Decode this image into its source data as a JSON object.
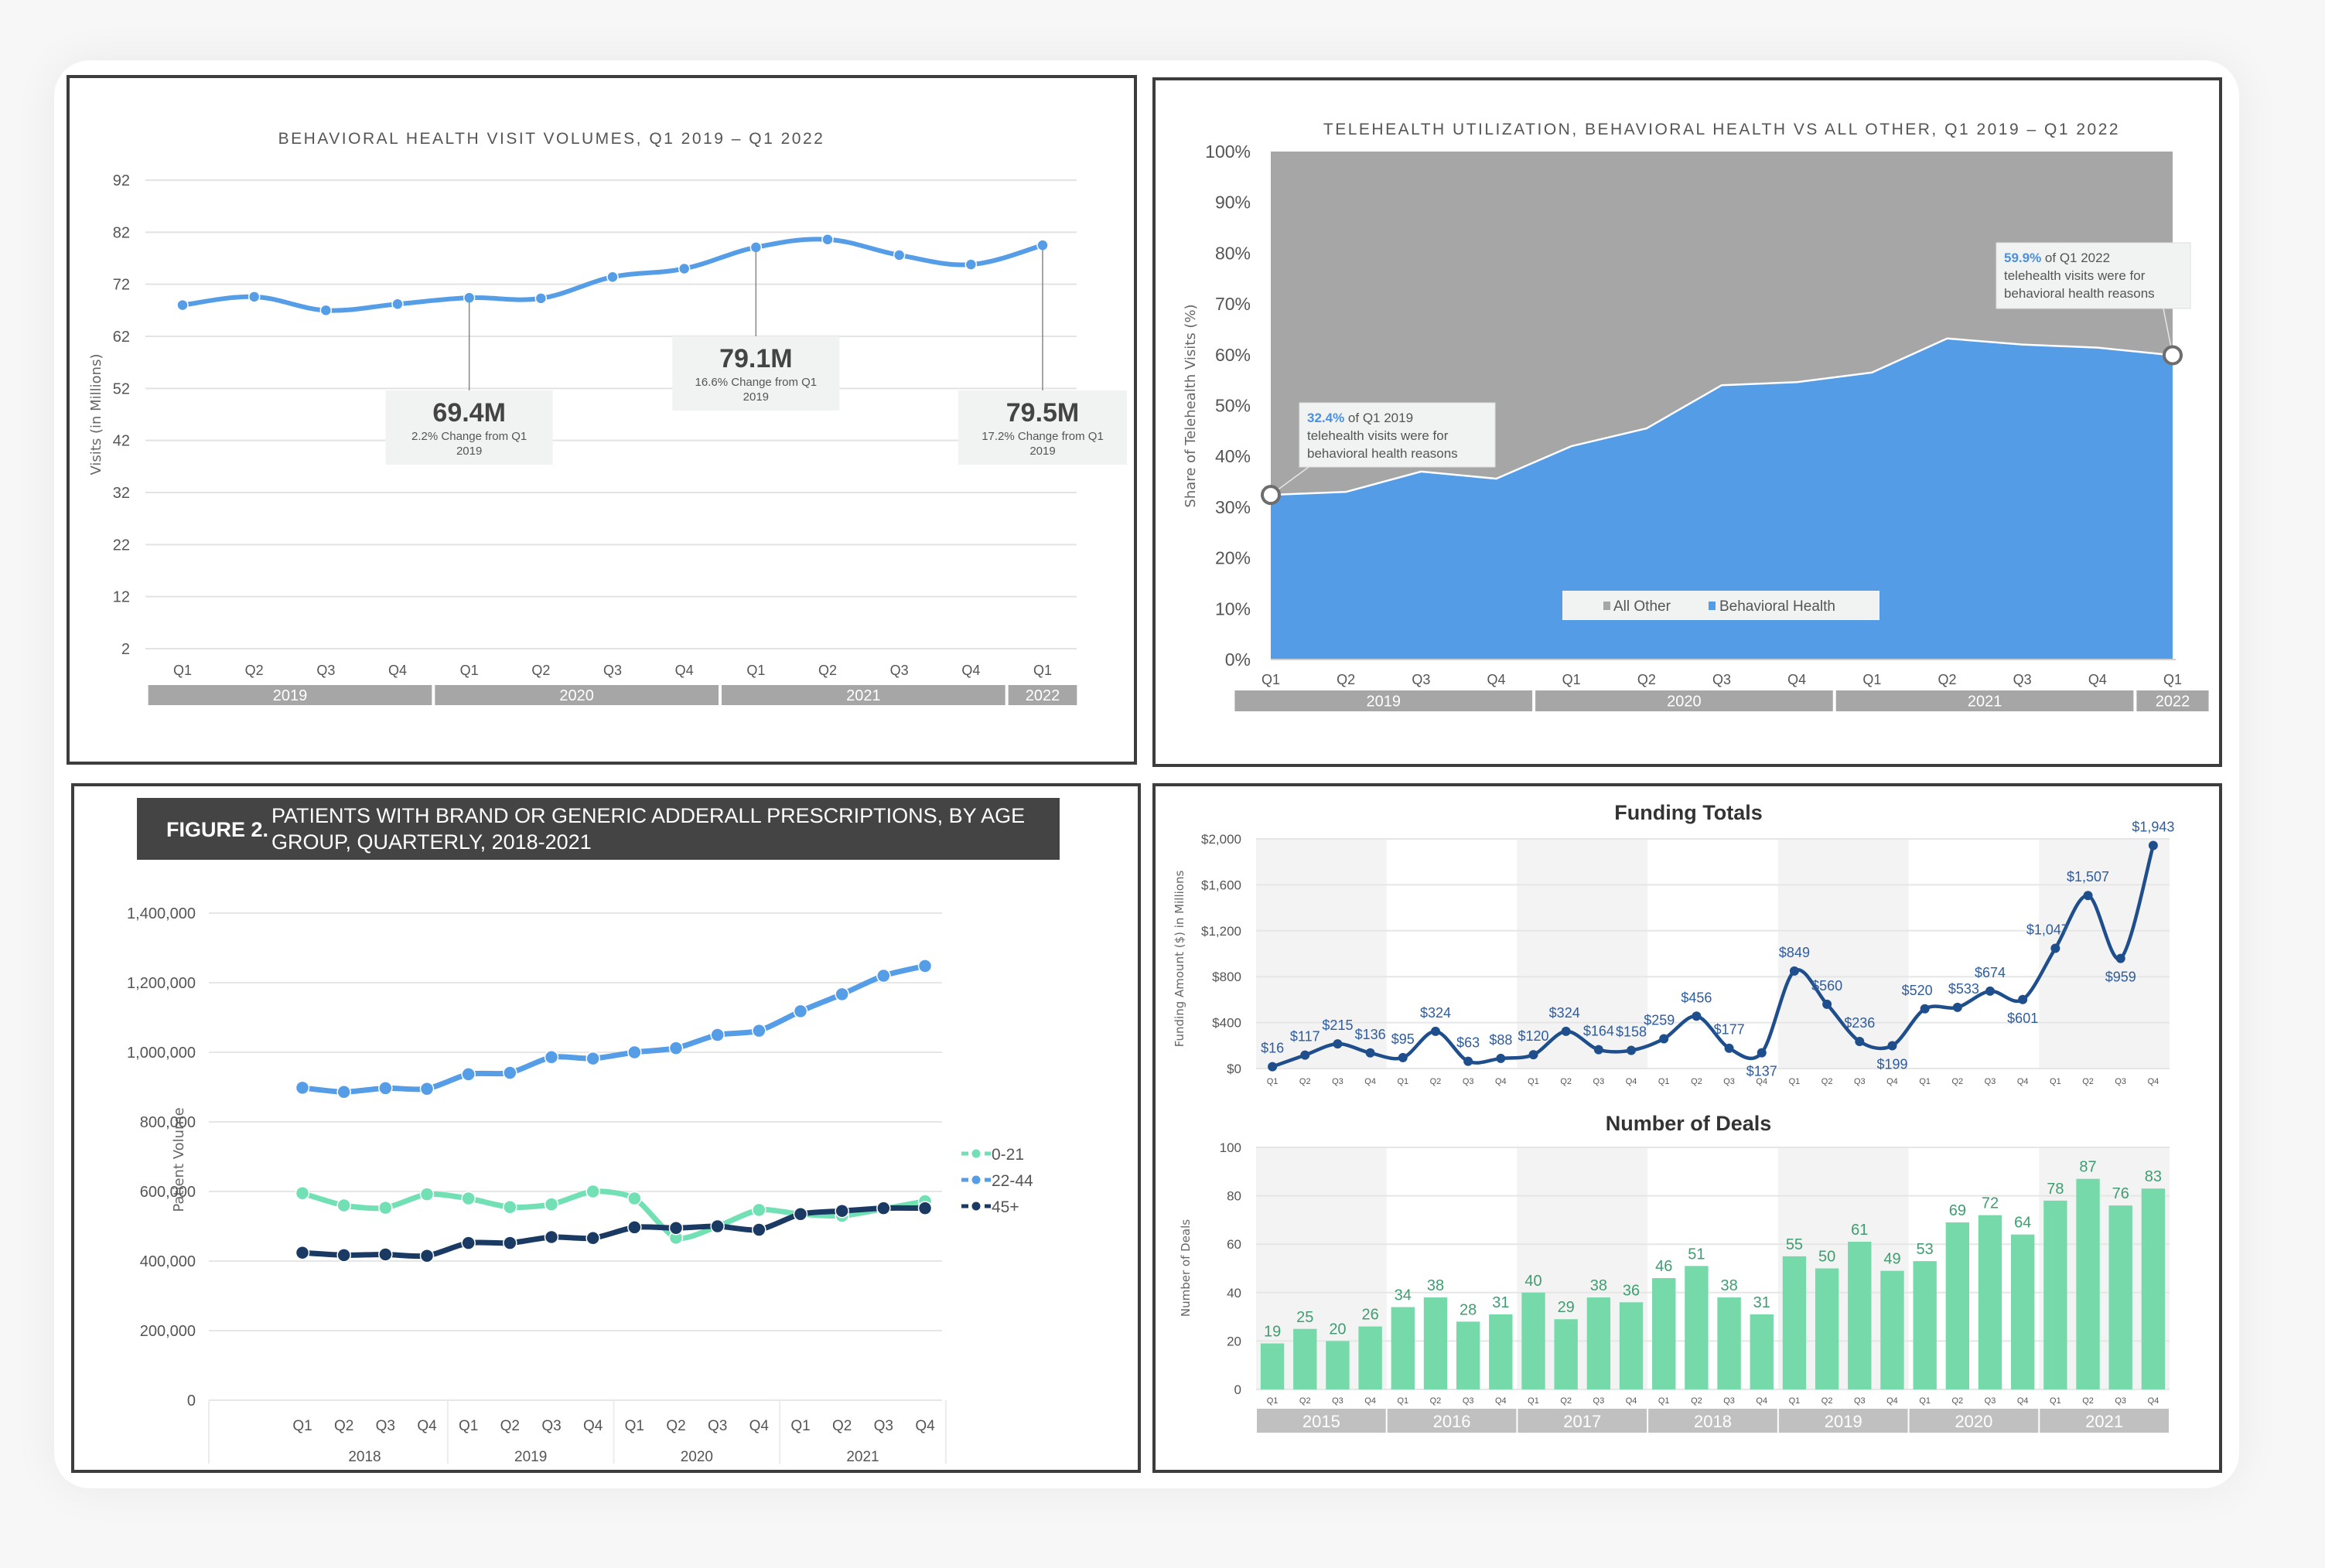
{
  "chart_data": [
    {
      "id": "visit-volumes",
      "type": "line",
      "title": "BEHAVIORAL HEALTH VISIT VOLUMES, Q1 2019 – Q1 2022",
      "xlabel": "",
      "ylabel": "Visits (in Millions)",
      "ylim": [
        2,
        92
      ],
      "yticks": [
        "92",
        "82",
        "72",
        "62",
        "52",
        "42",
        "32",
        "22",
        "12",
        "2"
      ],
      "grid": true,
      "categories": [
        "Q1",
        "Q2",
        "Q3",
        "Q4",
        "Q1",
        "Q2",
        "Q3",
        "Q4",
        "Q1",
        "Q2",
        "Q3",
        "Q4",
        "Q1"
      ],
      "year_groups": [
        {
          "label": "2019",
          "span": 4
        },
        {
          "label": "2020",
          "span": 4
        },
        {
          "label": "2021",
          "span": 4
        },
        {
          "label": "2022",
          "span": 1
        }
      ],
      "series": [
        {
          "name": "Visits",
          "color": "#559DE6",
          "values": [
            68.0,
            69.6,
            67.0,
            68.2,
            69.4,
            69.3,
            73.4,
            75.0,
            79.1,
            80.6,
            77.6,
            75.8,
            79.5
          ]
        }
      ],
      "annotations": [
        {
          "index": 4,
          "value": "69.4M",
          "text": "2.2% Change from Q1 2019"
        },
        {
          "index": 8,
          "value": "79.1M",
          "text": "16.6% Change from Q1 2019"
        },
        {
          "index": 12,
          "value": "79.5M",
          "text": "17.2% Change from Q1 2019"
        }
      ]
    },
    {
      "id": "telehealth-share",
      "type": "area",
      "title": "TELEHEALTH UTILIZATION, BEHAVIORAL HEALTH VS ALL OTHER, Q1 2019 – Q1 2022",
      "xlabel": "",
      "ylabel": "Share of Telehealth Visits (%)",
      "ylim": [
        0,
        100
      ],
      "yticks": [
        "100%",
        "90%",
        "80%",
        "70%",
        "60%",
        "50%",
        "40%",
        "30%",
        "20%",
        "10%",
        "0%"
      ],
      "categories": [
        "Q1",
        "Q2",
        "Q3",
        "Q4",
        "Q1",
        "Q2",
        "Q3",
        "Q4",
        "Q1",
        "Q2",
        "Q3",
        "Q4",
        "Q1"
      ],
      "year_groups": [
        {
          "label": "2019",
          "span": 4
        },
        {
          "label": "2020",
          "span": 4
        },
        {
          "label": "2021",
          "span": 4
        },
        {
          "label": "2022",
          "span": 1
        }
      ],
      "stacked": true,
      "series": [
        {
          "name": "All Other",
          "color": "#A6A6A6",
          "values": [
            67.6,
            67.0,
            63.0,
            64.4,
            58.0,
            54.5,
            46.0,
            45.4,
            43.5,
            36.8,
            38.0,
            38.6,
            40.1
          ]
        },
        {
          "name": "Behavioral Health",
          "color": "#559CE6",
          "values": [
            32.4,
            33.0,
            37.0,
            35.6,
            42.0,
            45.5,
            54.0,
            54.6,
            56.5,
            63.2,
            62.0,
            61.4,
            59.9
          ]
        }
      ],
      "legend": {
        "position": "bottom-center",
        "items": [
          "All Other",
          "Behavioral Health"
        ]
      },
      "annotations": [
        {
          "index": 0,
          "highlight": "32.4%",
          "text_1": " of Q1 2019",
          "text_2": "telehealth visits were for",
          "text_3": "behavioral health reasons"
        },
        {
          "index": 12,
          "highlight": "59.9%",
          "text_1": " of Q1 2022",
          "text_2": "telehealth visits were for",
          "text_3": "behavioral health reasons"
        }
      ]
    },
    {
      "id": "adderall-patients",
      "type": "line",
      "figure_label": "FIGURE 2.",
      "title": "PATIENTS WITH BRAND OR GENERIC ADDERALL PRESCRIPTIONS, BY AGE GROUP, QUARTERLY, 2018-2021",
      "xlabel": "",
      "ylabel": "Patient Volume",
      "ylim": [
        0,
        1400000
      ],
      "yticks": [
        "1,400,000",
        "1,200,000",
        "1,000,000",
        "800,000",
        "600,000",
        "400,000",
        "200,000",
        "0"
      ],
      "grid": true,
      "categories": [
        "Q1",
        "Q2",
        "Q3",
        "Q4",
        "Q1",
        "Q2",
        "Q3",
        "Q4",
        "Q1",
        "Q2",
        "Q3",
        "Q4",
        "Q1",
        "Q2",
        "Q3",
        "Q4"
      ],
      "year_groups": [
        {
          "label": "2018",
          "span": 4
        },
        {
          "label": "2019",
          "span": 4
        },
        {
          "label": "2020",
          "span": 4
        },
        {
          "label": "2021",
          "span": 4
        }
      ],
      "series": [
        {
          "name": "0-21",
          "color": "#72E0B5",
          "values": [
            595000,
            560000,
            553000,
            592000,
            580000,
            555000,
            563000,
            600000,
            580000,
            467000,
            500000,
            547000,
            535000,
            530000,
            550000,
            572000
          ]
        },
        {
          "name": "22-44",
          "color": "#559DE6",
          "values": [
            898000,
            886000,
            897000,
            895000,
            937000,
            941000,
            986000,
            982000,
            1000000,
            1012000,
            1050000,
            1062000,
            1118000,
            1167000,
            1220000,
            1248000
          ]
        },
        {
          "name": "45+",
          "color": "#1B3A63",
          "values": [
            424000,
            417000,
            419000,
            415000,
            452000,
            452000,
            469000,
            466000,
            497000,
            495000,
            500000,
            490000,
            535000,
            544000,
            552000,
            552000
          ]
        }
      ],
      "legend": {
        "position": "right",
        "items": [
          "0-21",
          "22-44",
          "45+"
        ]
      }
    },
    {
      "id": "funding-totals",
      "type": "line",
      "title": "Funding Totals",
      "xlabel": "",
      "ylabel": "Funding Amount ($) in Millions",
      "ylim": [
        0,
        2000
      ],
      "yticks": [
        "$2,000",
        "$1,600",
        "$1,200",
        "$800",
        "$400",
        "$0"
      ],
      "grid": true,
      "categories": [
        "Q1",
        "Q2",
        "Q3",
        "Q4",
        "Q1",
        "Q2",
        "Q3",
        "Q4",
        "Q1",
        "Q2",
        "Q3",
        "Q4",
        "Q1",
        "Q2",
        "Q3",
        "Q4",
        "Q1",
        "Q2",
        "Q3",
        "Q4",
        "Q1",
        "Q2",
        "Q3",
        "Q4",
        "Q1",
        "Q2",
        "Q3",
        "Q4"
      ],
      "year_groups": [
        {
          "label": "2015",
          "span": 4
        },
        {
          "label": "2016",
          "span": 4
        },
        {
          "label": "2017",
          "span": 4
        },
        {
          "label": "2018",
          "span": 4
        },
        {
          "label": "2019",
          "span": 4
        },
        {
          "label": "2020",
          "span": 4
        },
        {
          "label": "2021",
          "span": 4
        }
      ],
      "series": [
        {
          "name": "Funding",
          "color": "#1F4E8C",
          "values": [
            16,
            117,
            215,
            136,
            95,
            324,
            63,
            88,
            120,
            324,
            164,
            158,
            259,
            456,
            177,
            137,
            849,
            560,
            236,
            199,
            520,
            533,
            674,
            601,
            1047,
            1507,
            959,
            1943
          ],
          "labels": [
            "$16",
            "$117",
            "$215",
            "$136",
            "$95",
            "$324",
            "$63",
            "$88",
            "$120",
            "$324",
            "$164",
            "$158",
            "$259",
            "$456",
            "$177",
            "$137",
            "$849",
            "$560",
            "$236",
            "$199",
            "$520",
            "$533",
            "$674",
            "$601",
            "$1,047",
            "$1,507",
            "$959",
            "$1,943"
          ]
        }
      ]
    },
    {
      "id": "number-of-deals",
      "type": "bar",
      "title": "Number of Deals",
      "xlabel": "",
      "ylabel": "Number of Deals",
      "ylim": [
        0,
        100
      ],
      "yticks": [
        "100",
        "80",
        "60",
        "40",
        "20",
        "0"
      ],
      "grid": true,
      "categories": [
        "Q1",
        "Q2",
        "Q3",
        "Q4",
        "Q1",
        "Q2",
        "Q3",
        "Q4",
        "Q1",
        "Q2",
        "Q3",
        "Q4",
        "Q1",
        "Q2",
        "Q3",
        "Q4",
        "Q1",
        "Q2",
        "Q3",
        "Q4",
        "Q1",
        "Q2",
        "Q3",
        "Q4",
        "Q1",
        "Q2",
        "Q3",
        "Q4"
      ],
      "year_groups": [
        {
          "label": "2015",
          "span": 4
        },
        {
          "label": "2016",
          "span": 4
        },
        {
          "label": "2017",
          "span": 4
        },
        {
          "label": "2018",
          "span": 4
        },
        {
          "label": "2019",
          "span": 4
        },
        {
          "label": "2020",
          "span": 4
        },
        {
          "label": "2021",
          "span": 4
        }
      ],
      "series": [
        {
          "name": "Deals",
          "color": "#76D9A9",
          "label_color": "#3E9E72",
          "values": [
            19,
            25,
            20,
            26,
            34,
            38,
            28,
            31,
            40,
            29,
            38,
            36,
            46,
            51,
            38,
            31,
            55,
            50,
            61,
            49,
            53,
            69,
            72,
            64,
            78,
            87,
            76,
            83
          ]
        }
      ]
    }
  ]
}
